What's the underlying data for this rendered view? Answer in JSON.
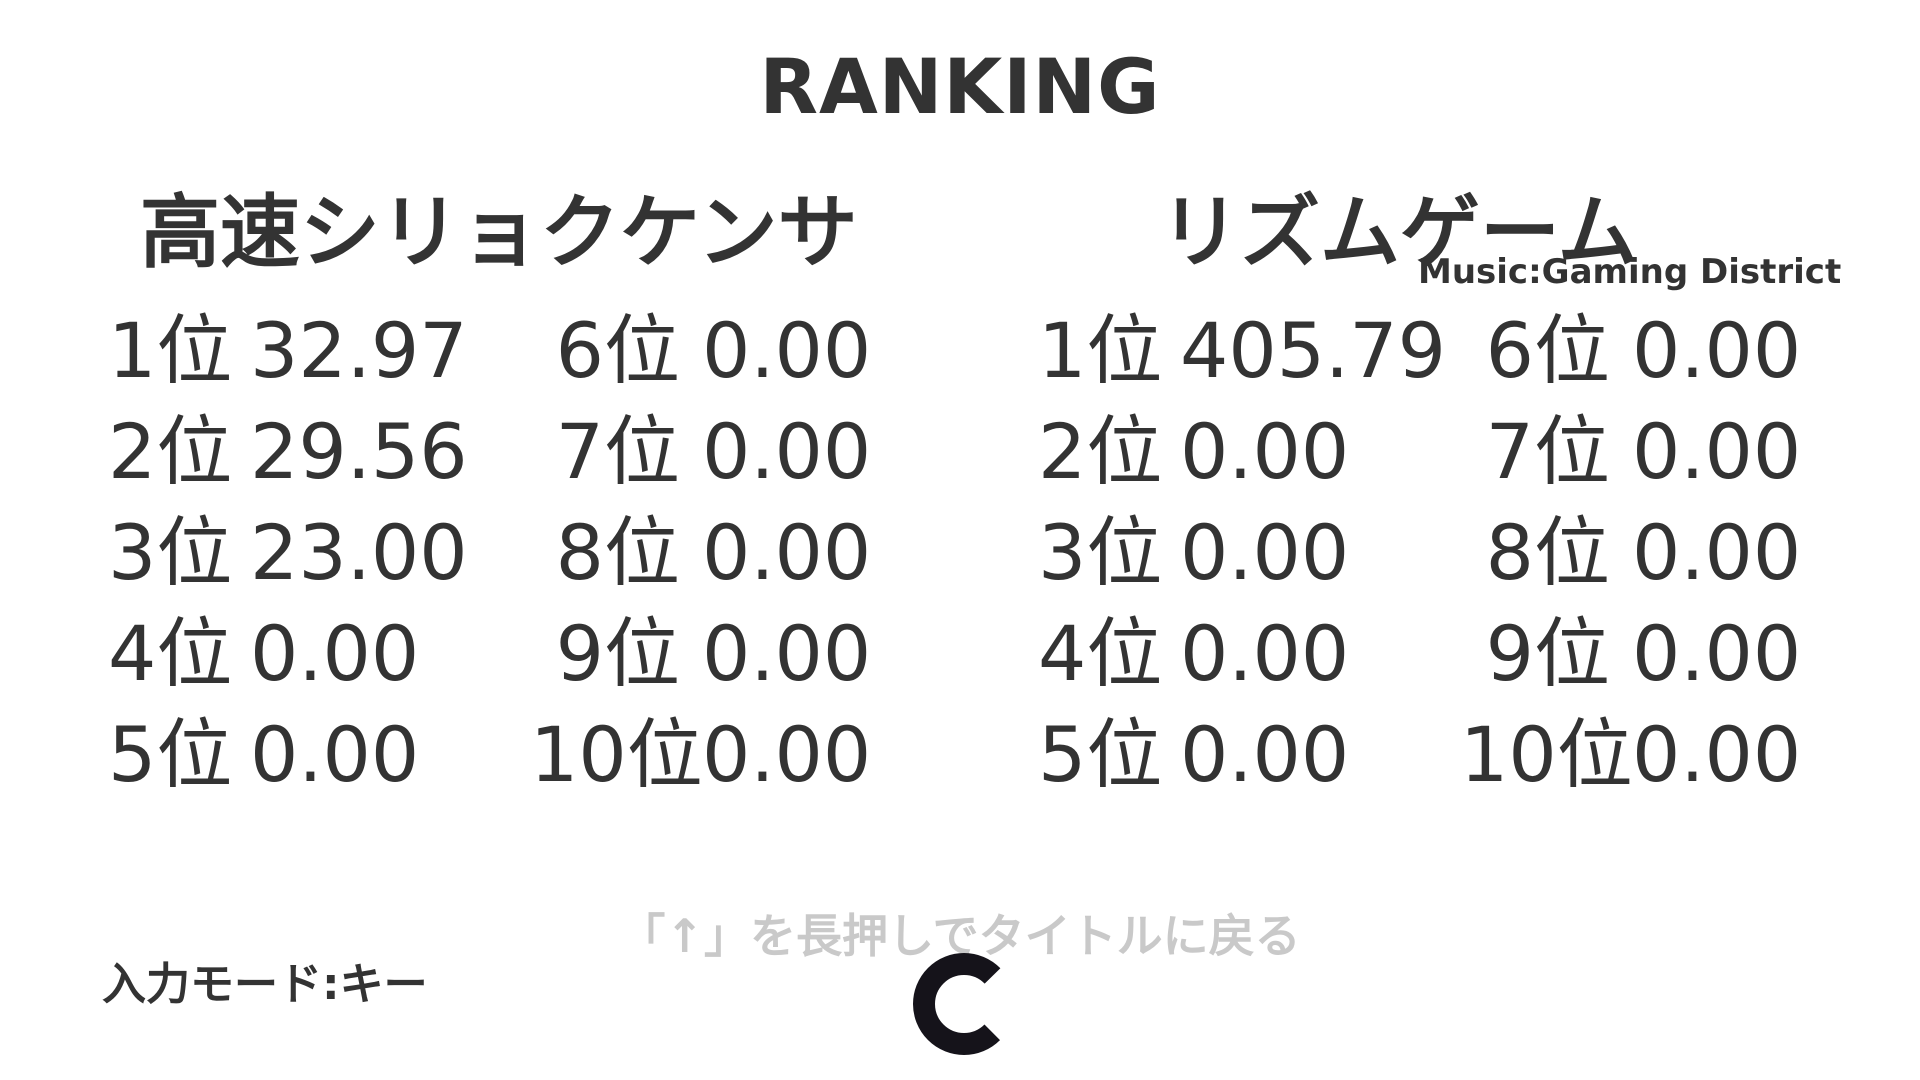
{
  "header": {
    "title": "RANKING"
  },
  "games": [
    {
      "title": "高速シリョクケンサ",
      "ranks": [
        {
          "rank": "1位",
          "score": "32.97"
        },
        {
          "rank": "2位",
          "score": "29.56"
        },
        {
          "rank": "3位",
          "score": "23.00"
        },
        {
          "rank": "4位",
          "score": "0.00"
        },
        {
          "rank": "5位",
          "score": "0.00"
        },
        {
          "rank": "6位",
          "score": "0.00"
        },
        {
          "rank": "7位",
          "score": "0.00"
        },
        {
          "rank": "8位",
          "score": "0.00"
        },
        {
          "rank": "9位",
          "score": "0.00"
        },
        {
          "rank": "10位",
          "score": "0.00"
        }
      ]
    },
    {
      "title": "リズムゲーム",
      "music_credit": "Music:Gaming District",
      "ranks": [
        {
          "rank": "1位",
          "score": "405.79"
        },
        {
          "rank": "2位",
          "score": "0.00"
        },
        {
          "rank": "3位",
          "score": "0.00"
        },
        {
          "rank": "4位",
          "score": "0.00"
        },
        {
          "rank": "5位",
          "score": "0.00"
        },
        {
          "rank": "6位",
          "score": "0.00"
        },
        {
          "rank": "7位",
          "score": "0.00"
        },
        {
          "rank": "8位",
          "score": "0.00"
        },
        {
          "rank": "9位",
          "score": "0.00"
        },
        {
          "rank": "10位",
          "score": "0.00"
        }
      ]
    }
  ],
  "footer": {
    "hint": "「↑」を長押しでタイトルに戻る",
    "input_mode": "入力モード:キー",
    "hold_progress": 0.75,
    "hold_icon": "circular-progress-icon"
  },
  "colors": {
    "text": "#333333",
    "hint": "#c9c9c9",
    "indicator": "#15131a"
  }
}
